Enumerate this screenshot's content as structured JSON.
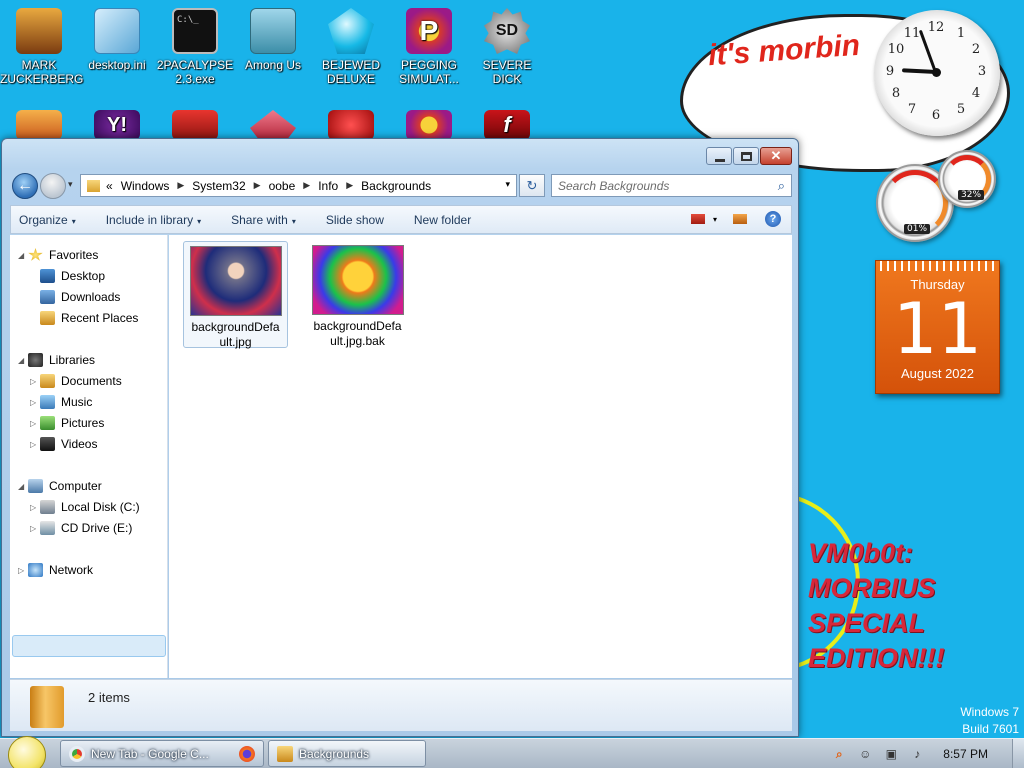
{
  "desktop": {
    "icons_row1": [
      {
        "label": "MARK ZUCKERBERG",
        "icon": "person-icon"
      },
      {
        "label": "desktop.ini",
        "icon": "settings-file-icon"
      },
      {
        "label": "2PACALYPSE 2.3.exe",
        "icon": "console-exe-icon"
      },
      {
        "label": "Among Us",
        "icon": "game-icon"
      },
      {
        "label": "BEJEWED DELUXE",
        "icon": "gem-icon"
      },
      {
        "label": "PEGGING SIMULAT...",
        "icon": "peggle-icon"
      },
      {
        "label": "SEVERE DICK",
        "icon": "gear-sd-icon"
      }
    ],
    "icons_row2": [
      "folder-app-icon",
      "yahoo-icon",
      "angry-bird-icon",
      "pink-app-icon",
      "pin-app-icon",
      "peggle-icon",
      "flash-icon"
    ],
    "row2_glyphs": {
      "yahoo": "Y!",
      "flash": "f"
    },
    "exe_glyph": "C:\\_",
    "peggle_glyph": "P",
    "sd_glyph": "SD"
  },
  "gadgets": {
    "cloud_text": "it's morbin",
    "clock": {
      "numbers": [
        "12",
        "1",
        "2",
        "3",
        "4",
        "5",
        "6",
        "7",
        "8",
        "9",
        "10",
        "11"
      ]
    },
    "meters": {
      "cpu": "01%",
      "ram": "32%"
    },
    "calendar": {
      "weekday": "Thursday",
      "day": "11",
      "month_year": "August 2022"
    },
    "overlay_lines": [
      "VM0b0t:",
      "MORBIUS",
      "SPECIAL",
      "EDITION!!!"
    ],
    "windows_version": {
      "line1": "Windows 7",
      "line2": "Build 7601"
    }
  },
  "window": {
    "caption": {
      "minimize": "–",
      "maximize": "□",
      "close": "✕"
    },
    "back_glyph": "←",
    "history_glyph": "▾",
    "breadcrumb_prefix": "«",
    "breadcrumb": [
      "Windows",
      "System32",
      "oobe",
      "Info",
      "Backgrounds"
    ],
    "refresh_glyph": "↻",
    "search_placeholder": "Search Backgrounds",
    "search_glyph": "⌕",
    "commands": {
      "organize": "Organize",
      "include": "Include in library",
      "share": "Share with",
      "slideshow": "Slide show",
      "newfolder": "New folder",
      "help": "?"
    },
    "dropdown_glyph": "▾",
    "nav": {
      "favorites": "Favorites",
      "desktop": "Desktop",
      "downloads": "Downloads",
      "recent": "Recent Places",
      "libraries": "Libraries",
      "documents": "Documents",
      "music": "Music",
      "pictures": "Pictures",
      "videos": "Videos",
      "computer": "Computer",
      "local_disk": "Local Disk (C:)",
      "cd_drive": "CD Drive (E:)",
      "network": "Network"
    },
    "tree_glyphs": {
      "expanded": "◢",
      "collapsed": "▷"
    },
    "files": [
      {
        "name_line1": "backgroundDefa",
        "name_line2": "ult.jpg"
      },
      {
        "name_line1": "backgroundDefa",
        "name_line2": "ult.jpg.bak"
      }
    ],
    "status": "2 items"
  },
  "taskbar": {
    "buttons": [
      {
        "label": "New Tab - Google C...",
        "icon": "chrome-icon"
      },
      {
        "label": "",
        "icon": "firefox-icon"
      },
      {
        "label": "Backgrounds",
        "icon": "folder-icon"
      }
    ],
    "tray_glyphs": {
      "search": "⌕",
      "smile": "☺",
      "network": "▣",
      "volume": "♪"
    },
    "time": "8:57 PM"
  },
  "colors": {
    "desktop_bg": "#19b3ea",
    "cloud_text": "#e0261c",
    "overlay_text": "#d7273a",
    "calendar": "#e8650f"
  }
}
